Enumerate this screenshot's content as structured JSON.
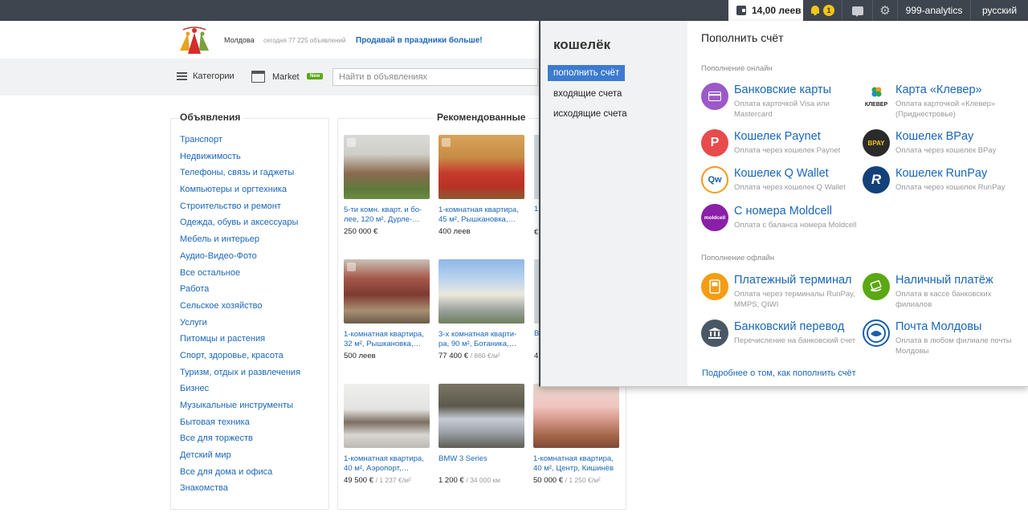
{
  "topbar": {
    "wallet_amount": "14,00 леев",
    "notifications_count": "1",
    "user": "999-analytics",
    "language": "русский"
  },
  "header": {
    "region": "Молдова",
    "today": "сегодня 77 225 объявлений",
    "promo": "Продавай в праздники больше!"
  },
  "nav": {
    "categories_label": "Категории",
    "market_label": "Market",
    "market_badge": "New",
    "search_placeholder": "Найти в объявлениях"
  },
  "ads_panel": {
    "title": "Объявления",
    "categories": [
      "Транспорт",
      "Недвижимость",
      "Телефоны, связь и гаджеты",
      "Компьютеры и оргтехника",
      "Строительство и ремонт",
      "Одежда, обувь и аксессуары",
      "Мебель и интерьер",
      "Аудио-Видео-Фото",
      "Все остальное",
      "Работа",
      "Сельское хозяйство",
      "Услуги",
      "Питомцы и растения",
      "Спорт, здоровье, красота",
      "Туризм, отдых и развлечения",
      "Бизнес",
      "Музыкальные инструменты",
      "Бытовая техника",
      "Все для торжеств",
      "Детский мир",
      "Все для дома и офиса",
      "Знакомства"
    ]
  },
  "recommended": {
    "title": "Рекомендованные",
    "items": [
      {
        "title": "5-ти комн. кварт. и бо-лее, 120 м², Дурле-…",
        "price": "250 000 €",
        "unit": ""
      },
      {
        "title": "1-комнатная квартира, 45 м², Рышкановка,…",
        "price": "400 леев",
        "unit": ""
      },
      {
        "title": "1-комнатная квартира, 32 м², Рышкановка,…",
        "price": "500 леев",
        "unit": ""
      },
      {
        "title": "3-х комнатная кварти-ра, 90 м², Ботаника,…",
        "price": "77 400 € ",
        "unit": "/ 860 €/м²"
      },
      {
        "title": "1-комнатная квартира, 40 м², Аэропорт,…",
        "price": "49 500 € ",
        "unit": "/ 1 237 €/м²"
      },
      {
        "title": "BMW 3 Series",
        "price": "1 200 € ",
        "unit": "/ 34 000 км"
      },
      {
        "title": "1-комнатная квартира, 40 м², Центр, Кишинёв",
        "price": "50 000 € ",
        "unit": "/ 1 250 €/м²"
      }
    ],
    "partial": [
      {
        "title": "1",
        "price": "€"
      },
      {
        "title": "В",
        "price": "4"
      }
    ]
  },
  "wallet": {
    "title": "кошелёк",
    "menu": [
      "пополнить счёт",
      "входящие счета",
      "исходящие счета"
    ],
    "topup_title": "Пополнить счёт",
    "online_label": "Пополнение онлайн",
    "offline_label": "Пополнение офлайн",
    "online": [
      {
        "name": "Банковские карты",
        "desc": "Оплата карточкой Visa или Mastercard",
        "icon": "card-icon",
        "color": "#9b59c9"
      },
      {
        "name": "Карта «Клевер»",
        "desc": "Оплата карточкой «Клевер» (Приднестровье)",
        "icon": "klever-logo",
        "color": "#2aa84a",
        "icon_text": "КЛЕВЕР"
      },
      {
        "name": "Кошелек Paynet",
        "desc": "Оплата через кошелек Paynet",
        "icon": "paynet-logo",
        "color": "#e84b4b",
        "icon_text": "P"
      },
      {
        "name": "Кошелек BPay",
        "desc": "Оплата через кошелек BPay",
        "icon": "bpay-logo",
        "color": "#2b2b2b",
        "icon_text": "BPAY"
      },
      {
        "name": "Кошелек Q Wallet",
        "desc": "Оплата через кошелек Q Wallet",
        "icon": "qwallet-logo",
        "color": "#f39a1e",
        "icon_text": "Qw"
      },
      {
        "name": "Кошелек RunPay",
        "desc": "Оплата через кошелек RunPay",
        "icon": "runpay-logo",
        "color": "#14407a",
        "icon_text": "R"
      },
      {
        "name": "С номера Moldcell",
        "desc": "Оплата с баланса номера Moldcell",
        "icon": "moldcell-logo",
        "color": "#8a1fa8",
        "icon_text": "moldcell"
      }
    ],
    "offline": [
      {
        "name": "Платежный терминал",
        "desc": "Оплата через терминалы RunPay, MMPS, QIWI",
        "icon": "terminal-icon",
        "color": "#f49c13"
      },
      {
        "name": "Наличный платёж",
        "desc": "Оплата в кассе банковских филиалов",
        "icon": "cash-icon",
        "color": "#5aa814"
      },
      {
        "name": "Банковский перевод",
        "desc": "Перечисление на банковский счет",
        "icon": "bank-icon",
        "color": "#4a5866"
      },
      {
        "name": "Почта Молдовы",
        "desc": "Оплата в любом филиале почты Молдовы",
        "icon": "posta-logo",
        "color": "#1a5ea8"
      }
    ],
    "more_link": "Подробнее о том, как пополнить счёт"
  }
}
